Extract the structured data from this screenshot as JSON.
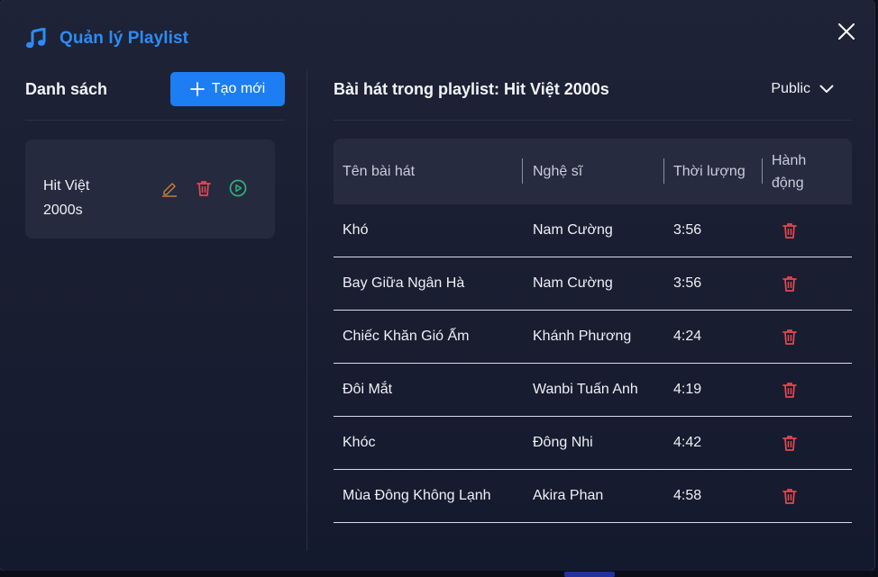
{
  "modal": {
    "title": "Quản lý Playlist",
    "icon": "music-note-icon",
    "close_icon": "close-icon"
  },
  "colors": {
    "accent": "#2b8cf5",
    "button": "#1c7ef2",
    "edit": "#c47c3e",
    "delete": "#e5484d",
    "play": "#2fb07a"
  },
  "left_panel": {
    "title": "Danh sách",
    "create_label": "Tạo mới",
    "playlists": [
      {
        "name": "Hit Việt 2000s"
      }
    ]
  },
  "right_panel": {
    "title": "Bài hát trong playlist: Hit Việt 2000s",
    "visibility": "Public",
    "columns": [
      "Tên bài hát",
      "Nghệ sĩ",
      "Thời lượng",
      "Hành động"
    ],
    "songs": [
      {
        "title": "Khó",
        "artist": "Nam Cường",
        "duration": "3:56"
      },
      {
        "title": "Bay Giữa Ngân Hà",
        "artist": "Nam Cường",
        "duration": "3:56"
      },
      {
        "title": "Chiếc Khăn Gió Ấm",
        "artist": "Khánh Phương",
        "duration": "4:24"
      },
      {
        "title": "Đôi Mắt",
        "artist": "Wanbi Tuấn Anh",
        "duration": "4:19"
      },
      {
        "title": "Khóc",
        "artist": "Đông Nhi",
        "duration": "4:42"
      },
      {
        "title": "Mùa Đông Không Lạnh",
        "artist": "Akira Phan",
        "duration": "4:58"
      }
    ]
  }
}
